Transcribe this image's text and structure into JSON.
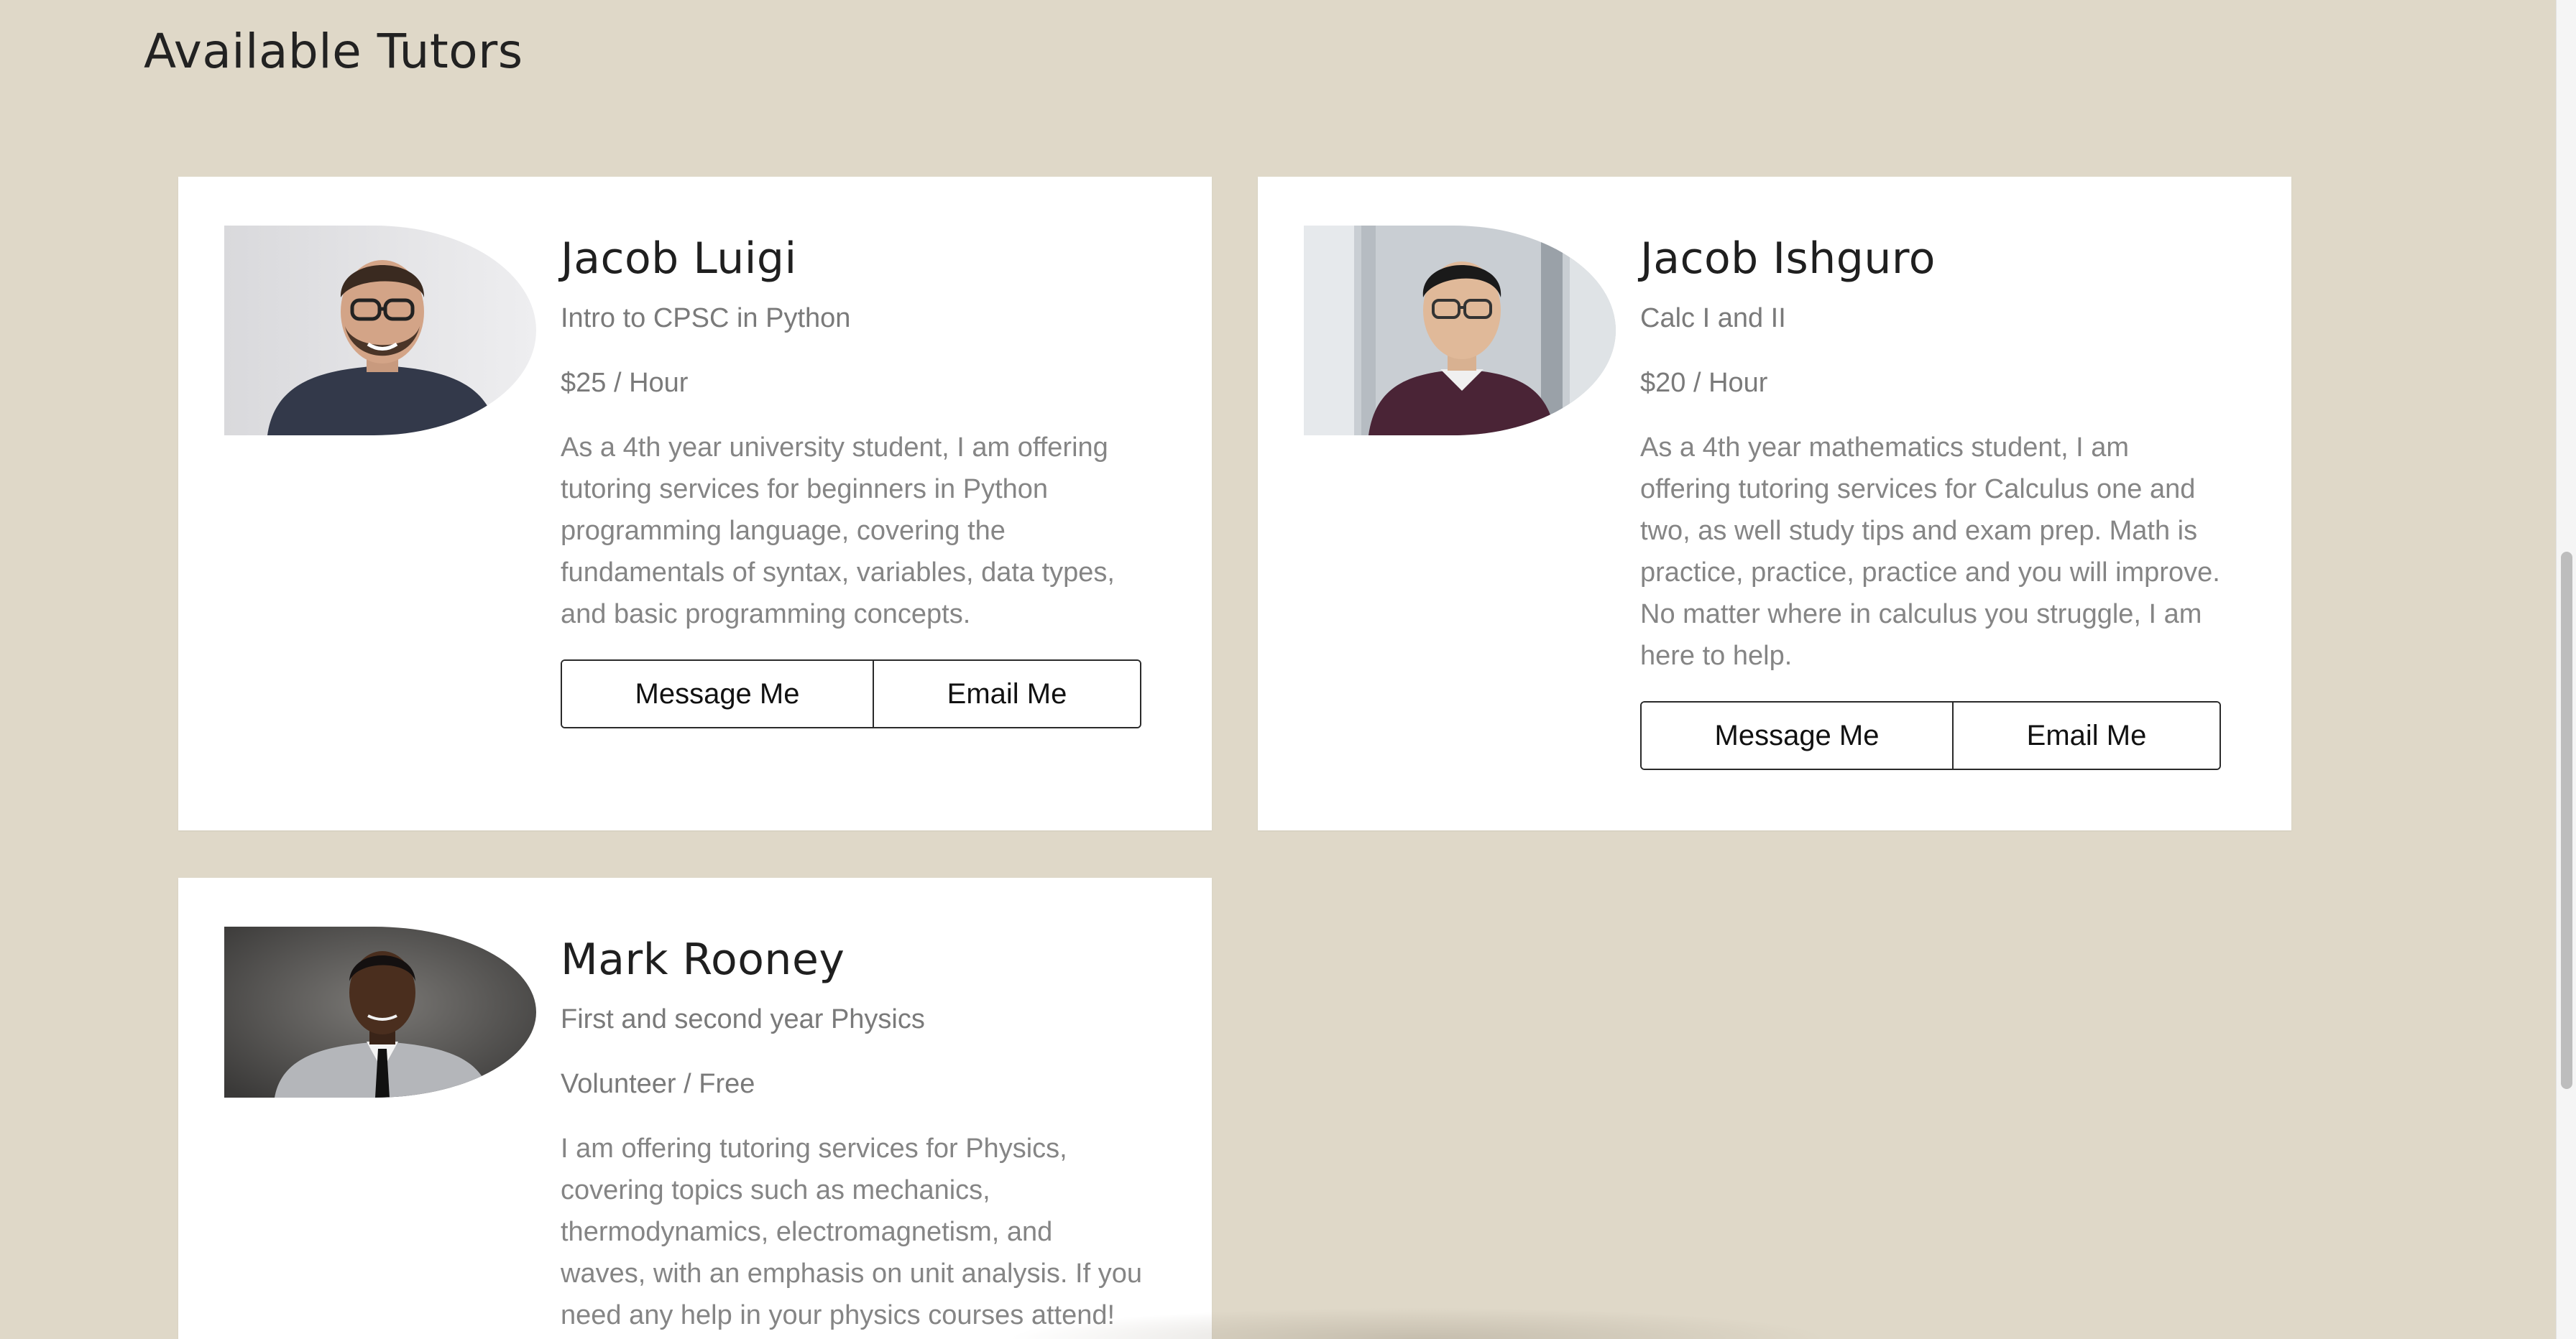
{
  "page": {
    "title": "Available Tutors",
    "background_color": "#dfd8c8"
  },
  "tutors": [
    {
      "name": "Jacob Luigi",
      "course": "Intro to CPSC in Python",
      "rate": "$25 / Hour",
      "description": "As a 4th year university student, I am offering tutoring services for beginners in Python programming language, covering the fundamentals of syntax, variables, data types, and basic programming concepts.",
      "message_label": "Message Me",
      "email_label": "Email Me",
      "photo_icon": "tutor-photo"
    },
    {
      "name": "Jacob Ishguro",
      "course": "Calc I and II",
      "rate": "$20 / Hour",
      "description": "As a 4th year mathematics student, I am offering tutoring services for Calculus one and two, as well study tips and exam prep. Math is practice, practice, practice and you will improve. No matter where in calculus you struggle, I am here to help.",
      "message_label": "Message Me",
      "email_label": "Email Me",
      "photo_icon": "tutor-photo"
    },
    {
      "name": "Mark Rooney",
      "course": "First and second year Physics",
      "rate": "Volunteer / Free",
      "description": "I am offering tutoring services for Physics, covering topics such as mechanics, thermodynamics, electromagnetism, and waves, with an emphasis on unit analysis. If you need any help in your physics courses attend!",
      "photo_icon": "tutor-photo"
    }
  ],
  "scrollbar": {
    "scroll_fraction": 0.62
  }
}
